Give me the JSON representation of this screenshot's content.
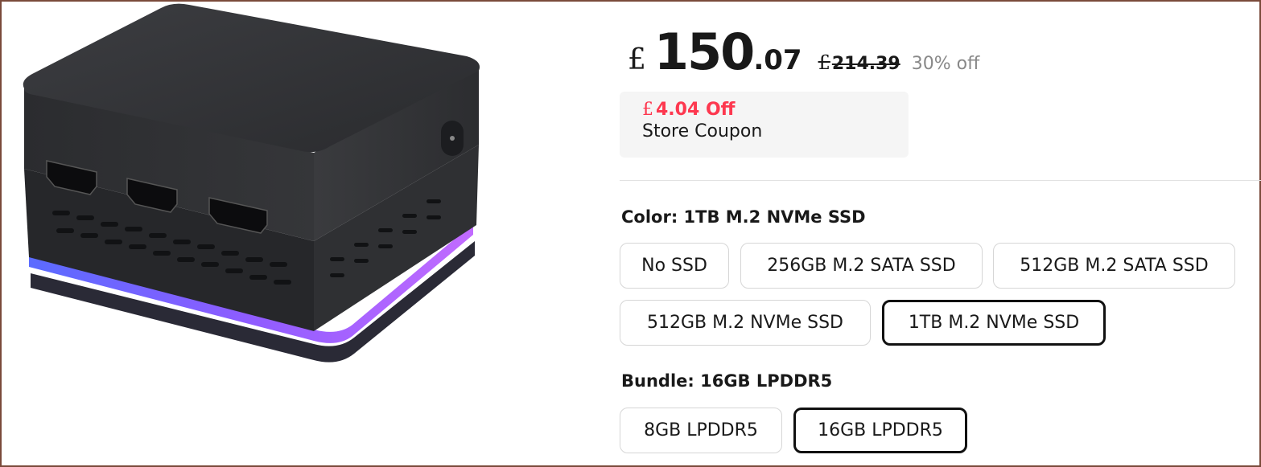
{
  "price": {
    "currency_symbol": "£",
    "integer": "150",
    "decimal": ".07",
    "original_currency_symbol": "£",
    "original_price": "214.39",
    "discount": "30% off"
  },
  "coupon": {
    "currency_symbol": "£",
    "amount": "4.04 Off",
    "label": "Store Coupon",
    "accent_color": "#fd384f"
  },
  "color_section": {
    "label": "Color: ",
    "selected": "1TB M.2 NVMe SSD",
    "options": [
      "No SSD",
      "256GB M.2 SATA SSD",
      "512GB M.2 SATA SSD",
      "512GB M.2 NVMe SSD",
      "1TB M.2 NVMe SSD"
    ]
  },
  "bundle_section": {
    "label": "Bundle: ",
    "selected": "16GB LPDDR5",
    "options": [
      "8GB LPDDR5",
      "16GB LPDDR5"
    ]
  },
  "product_image": {
    "icon": "mini-pc-image"
  }
}
